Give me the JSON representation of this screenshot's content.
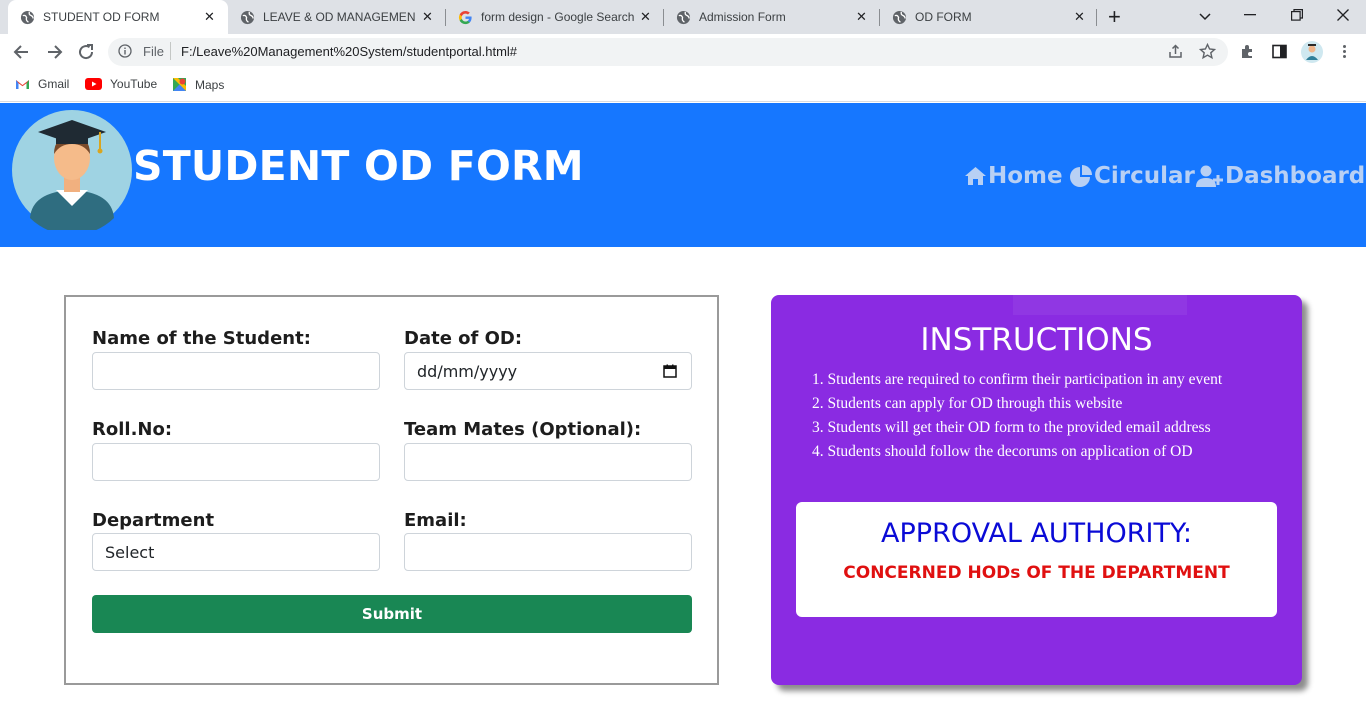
{
  "browser": {
    "tabs": [
      {
        "title": "STUDENT OD FORM",
        "active": true
      },
      {
        "title": "LEAVE & OD MANAGEMENT",
        "active": false
      },
      {
        "title": "form design - Google Search",
        "active": false
      },
      {
        "title": "Admission Form",
        "active": false
      },
      {
        "title": "OD FORM",
        "active": false
      }
    ],
    "address": {
      "scheme_label": "File",
      "url": "F:/Leave%20Management%20System/studentportal.html#"
    },
    "bookmarks": [
      {
        "label": "Gmail",
        "icon": "gmail-icon"
      },
      {
        "label": "YouTube",
        "icon": "youtube-icon"
      },
      {
        "label": "Maps",
        "icon": "maps-icon"
      }
    ]
  },
  "header": {
    "title": "STUDENT OD FORM",
    "nav": [
      {
        "label": "Home",
        "icon": "home-icon"
      },
      {
        "label": "Circular",
        "icon": "pie-chart-icon"
      },
      {
        "label": "Dashboard",
        "icon": "user-plus-icon"
      }
    ]
  },
  "form": {
    "name_label": "Name of the Student:",
    "date_label": "Date of OD:",
    "date_placeholder": "dd/mm/yyyy",
    "roll_label": "Roll.No:",
    "team_label": "Team Mates (Optional):",
    "dept_label": "Department",
    "dept_value": "Select",
    "email_label": "Email:",
    "submit_label": "Submit"
  },
  "instructions": {
    "title": "INSTRUCTIONS",
    "items": [
      "1. Students are required to confirm their participation in any event",
      "2. Students can apply for OD through this website",
      "3. Students will get their OD form to the provided email address",
      "4. Students should follow the decorums on application of OD"
    ],
    "approval_title": "APPROVAL AUTHORITY:",
    "approval_value": "CONCERNED HODs OF THE DEPARTMENT"
  },
  "colors": {
    "header_bg": "#1677ff",
    "instructions_bg": "#8a2be2",
    "submit_bg": "#198754",
    "approval_title": "#0a0ad6",
    "approval_value": "#e01010"
  }
}
